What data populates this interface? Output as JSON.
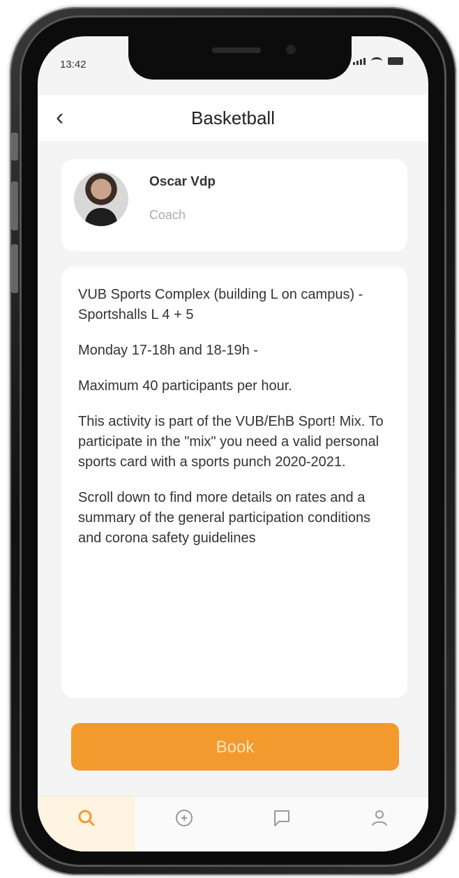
{
  "status_bar": {
    "time": "13:42"
  },
  "header": {
    "title": "Basketball",
    "back_icon": "chevron-left-icon"
  },
  "coach": {
    "name": "Oscar Vdp",
    "role": "Coach"
  },
  "description": {
    "paragraphs": [
      "VUB Sports Complex (building L on campus) - Sportshalls L 4 + 5",
      "Monday 17-18h and 18-19h -",
      "Maximum 40 participants per hour.",
      "This activity is part of the VUB/EhB Sport! Mix. To participate in the \"mix\" you need a valid personal sports card with a sports punch 2020-2021.",
      "Scroll down to find more details on rates and a summary of the general participation conditions and corona safety guidelines"
    ]
  },
  "book_button": {
    "label": "Book",
    "color": "#f39a2e"
  },
  "tab_bar": {
    "tabs": [
      {
        "icon": "search-icon",
        "active": true
      },
      {
        "icon": "plus-circle-icon",
        "active": false
      },
      {
        "icon": "chat-icon",
        "active": false
      },
      {
        "icon": "user-icon",
        "active": false
      }
    ]
  },
  "colors": {
    "accent": "#f39a2e",
    "background": "#f4f4f4",
    "card": "#ffffff"
  }
}
